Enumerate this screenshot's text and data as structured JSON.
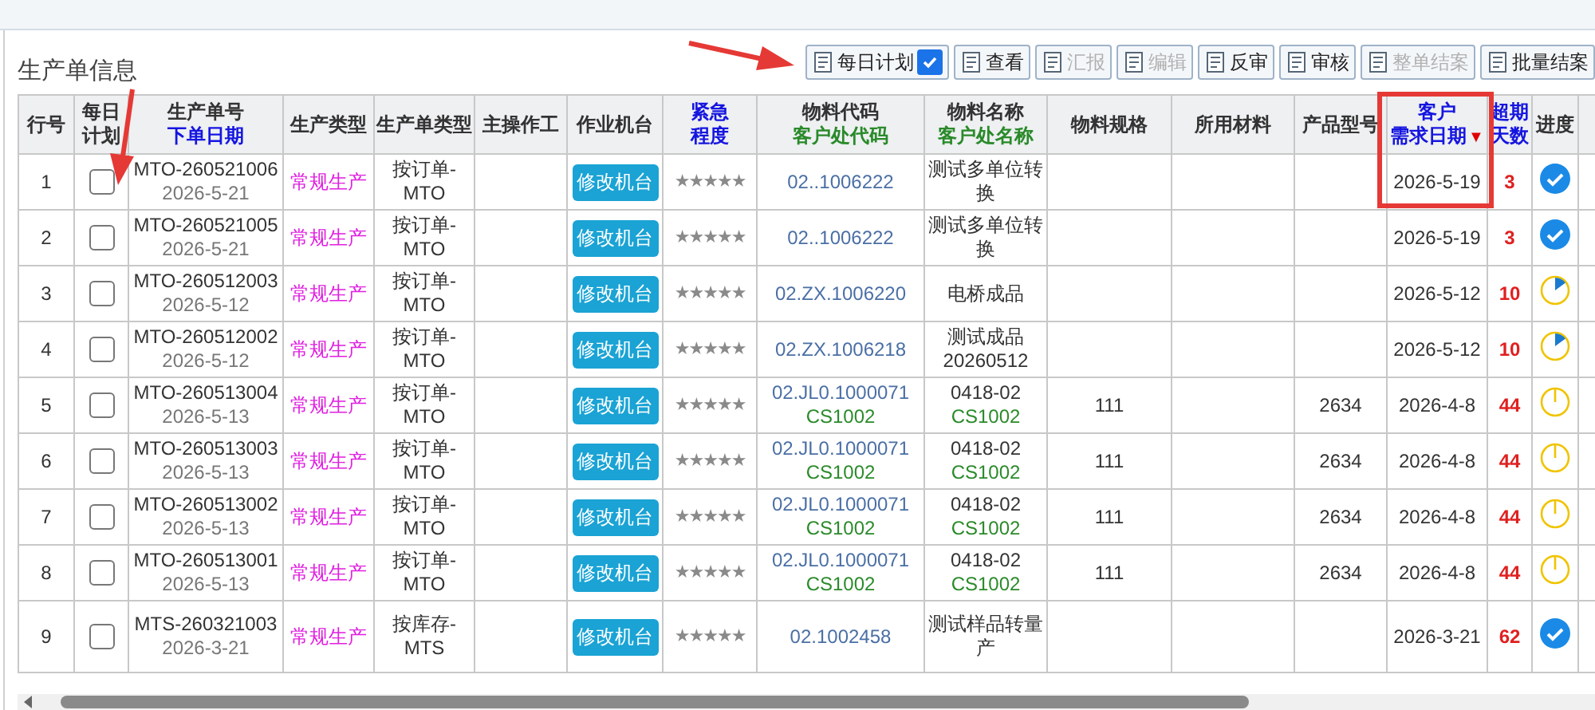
{
  "panel": {
    "title": "生产单信息"
  },
  "toolbar": [
    {
      "label": "每日计划",
      "disabled": false,
      "checked": true
    },
    {
      "label": "查看",
      "disabled": false
    },
    {
      "label": "汇报",
      "disabled": true
    },
    {
      "label": "编辑",
      "disabled": true
    },
    {
      "label": "反审",
      "disabled": false
    },
    {
      "label": "审核",
      "disabled": false
    },
    {
      "label": "整单结案",
      "disabled": true
    },
    {
      "label": "批量结案",
      "disabled": false
    }
  ],
  "table": {
    "columns": [
      {
        "lines": [
          {
            "text": "行号",
            "color": "#333333"
          }
        ]
      },
      {
        "lines": [
          {
            "text": "每日",
            "color": "#333333"
          },
          {
            "text": "计划",
            "color": "#333333"
          }
        ]
      },
      {
        "lines": [
          {
            "text": "生产单号",
            "color": "#333333"
          },
          {
            "text": "下单日期",
            "color": "#1515e0"
          }
        ]
      },
      {
        "lines": [
          {
            "text": "生产类型",
            "color": "#333333"
          }
        ]
      },
      {
        "lines": [
          {
            "text": "生产单类型",
            "color": "#333333"
          }
        ]
      },
      {
        "lines": [
          {
            "text": "主操作工",
            "color": "#333333"
          }
        ]
      },
      {
        "lines": [
          {
            "text": "作业机台",
            "color": "#333333"
          }
        ]
      },
      {
        "lines": [
          {
            "text": "紧急",
            "color": "#1515e0"
          },
          {
            "text": "程度",
            "color": "#1515e0"
          }
        ]
      },
      {
        "lines": [
          {
            "text": "物料代码",
            "color": "#333333"
          },
          {
            "text": "客户处代码",
            "color": "#2a8a2a"
          }
        ]
      },
      {
        "lines": [
          {
            "text": "物料名称",
            "color": "#333333"
          },
          {
            "text": "客户处名称",
            "color": "#2a8a2a"
          }
        ]
      },
      {
        "lines": [
          {
            "text": "物料规格",
            "color": "#333333"
          }
        ]
      },
      {
        "lines": [
          {
            "text": "所用材料",
            "color": "#333333"
          }
        ]
      },
      {
        "lines": [
          {
            "text": "产品型号",
            "color": "#333333"
          }
        ]
      },
      {
        "lines": [
          {
            "text": "客户",
            "color": "#1515e0"
          },
          {
            "text": "需求日期",
            "color": "#1515e0"
          }
        ],
        "sort": "▼"
      },
      {
        "lines": [
          {
            "text": "超期",
            "color": "#1515e0"
          },
          {
            "text": "天数",
            "color": "#1515e0"
          }
        ]
      },
      {
        "lines": [
          {
            "text": "进度",
            "color": "#333333"
          }
        ]
      }
    ],
    "rows": [
      {
        "row_no": "1",
        "daily_plan": false,
        "order_no": "MTO-260521006",
        "order_date": "2026-5-21",
        "prod_type": "常规生产",
        "order_type": "按订单-MTO",
        "machine_button": "修改机台",
        "stars": 5,
        "material_code": "02..1006222",
        "material_name": "测试多单位转换",
        "demand_date": "2026-5-19",
        "overdue_days": "3",
        "progress": {
          "kind": "done"
        }
      },
      {
        "row_no": "2",
        "daily_plan": false,
        "order_no": "MTO-260521005",
        "order_date": "2026-5-21",
        "prod_type": "常规生产",
        "order_type": "按订单-MTO",
        "machine_button": "修改机台",
        "stars": 5,
        "material_code": "02..1006222",
        "material_name": "测试多单位转换",
        "demand_date": "2026-5-19",
        "overdue_days": "3",
        "progress": {
          "kind": "done"
        }
      },
      {
        "row_no": "3",
        "daily_plan": false,
        "order_no": "MTO-260512003",
        "order_date": "2026-5-12",
        "prod_type": "常规生产",
        "order_type": "按订单-MTO",
        "machine_button": "修改机台",
        "stars": 5,
        "material_code": "02.ZX.1006220",
        "material_name": "电桥成品",
        "demand_date": "2026-5-12",
        "overdue_days": "10",
        "progress": {
          "kind": "started"
        }
      },
      {
        "row_no": "4",
        "daily_plan": false,
        "order_no": "MTO-260512002",
        "order_date": "2026-5-12",
        "prod_type": "常规生产",
        "order_type": "按订单-MTO",
        "machine_button": "修改机台",
        "stars": 5,
        "material_code": "02.ZX.1006218",
        "material_name": "测试成品20260512",
        "demand_date": "2026-5-12",
        "overdue_days": "10",
        "progress": {
          "kind": "started"
        }
      },
      {
        "row_no": "5",
        "daily_plan": false,
        "order_no": "MTO-260513004",
        "order_date": "2026-5-13",
        "prod_type": "常规生产",
        "order_type": "按订单-MTO",
        "machine_button": "修改机台",
        "stars": 5,
        "material_code": "02.JL0.1000071",
        "customer_code": "CS1002",
        "material_name": "0418-02",
        "customer_name": "CS1002",
        "spec": "111",
        "model": "2634",
        "demand_date": "2026-4-8",
        "overdue_days": "44",
        "progress": {
          "kind": "pending"
        }
      },
      {
        "row_no": "6",
        "daily_plan": false,
        "order_no": "MTO-260513003",
        "order_date": "2026-5-13",
        "prod_type": "常规生产",
        "order_type": "按订单-MTO",
        "machine_button": "修改机台",
        "stars": 5,
        "material_code": "02.JL0.1000071",
        "customer_code": "CS1002",
        "material_name": "0418-02",
        "customer_name": "CS1002",
        "spec": "111",
        "model": "2634",
        "demand_date": "2026-4-8",
        "overdue_days": "44",
        "progress": {
          "kind": "pending"
        }
      },
      {
        "row_no": "7",
        "daily_plan": false,
        "order_no": "MTO-260513002",
        "order_date": "2026-5-13",
        "prod_type": "常规生产",
        "order_type": "按订单-MTO",
        "machine_button": "修改机台",
        "stars": 5,
        "material_code": "02.JL0.1000071",
        "customer_code": "CS1002",
        "material_name": "0418-02",
        "customer_name": "CS1002",
        "spec": "111",
        "model": "2634",
        "demand_date": "2026-4-8",
        "overdue_days": "44",
        "progress": {
          "kind": "pending"
        }
      },
      {
        "row_no": "8",
        "daily_plan": false,
        "order_no": "MTO-260513001",
        "order_date": "2026-5-13",
        "prod_type": "常规生产",
        "order_type": "按订单-MTO",
        "machine_button": "修改机台",
        "stars": 5,
        "material_code": "02.JL0.1000071",
        "customer_code": "CS1002",
        "material_name": "0418-02",
        "customer_name": "CS1002",
        "spec": "111",
        "model": "2634",
        "demand_date": "2026-4-8",
        "overdue_days": "44",
        "progress": {
          "kind": "pending"
        }
      },
      {
        "row_no": "9",
        "daily_plan": false,
        "order_no": "MTS-260321003",
        "order_date": "2026-3-21",
        "prod_type": "常规生产",
        "order_type": "按库存-MTS",
        "machine_button": "修改机台",
        "stars": 5,
        "material_code": "02.1002458",
        "material_name": "测试样品转量产",
        "demand_date": "2026-3-21",
        "overdue_days": "62",
        "progress": {
          "kind": "done"
        }
      }
    ]
  }
}
